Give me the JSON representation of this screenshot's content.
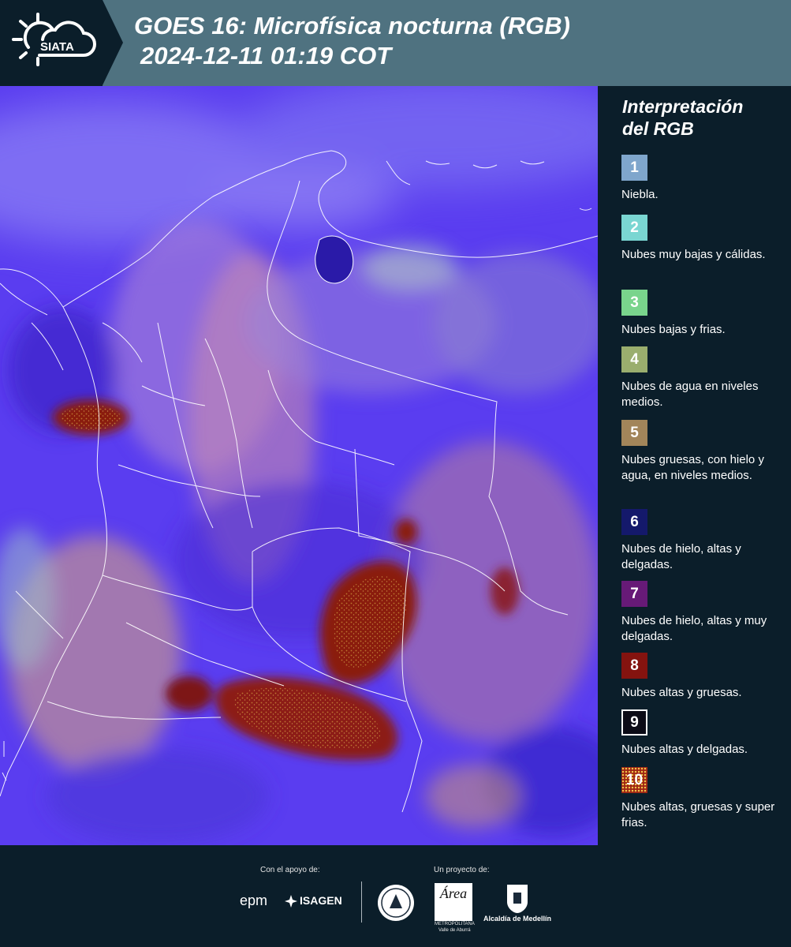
{
  "header": {
    "logo_text": "SIATA",
    "title_line1": "GOES 16: Microfísica nocturna (RGB)",
    "title_line2": "2024-12-11 01:19 COT"
  },
  "legend": {
    "title_line1": "Interpretación",
    "title_line2": "del RGB",
    "items": [
      {
        "number": "1",
        "label": "Niebla.",
        "color": "#7fa6cc"
      },
      {
        "number": "2",
        "label": "Nubes muy bajas y cálidas.",
        "color": "#7ad6d2"
      },
      {
        "number": "3",
        "label": "Nubes bajas y frias.",
        "color": "#79d48c"
      },
      {
        "number": "4",
        "label": "Nubes de agua en niveles medios.",
        "color": "#9aae6e"
      },
      {
        "number": "5",
        "label": "Nubes gruesas, con hielo y agua, en niveles medios.",
        "color": "#a2855a"
      },
      {
        "number": "6",
        "label": "Nubes de hielo, altas y delgadas.",
        "color": "#14196b"
      },
      {
        "number": "7",
        "label": "Nubes de hielo, altas y muy delgadas.",
        "color": "#671a77"
      },
      {
        "number": "8",
        "label": "Nubes altas y gruesas.",
        "color": "#84130f"
      },
      {
        "number": "9",
        "label": "Nubes altas y delgadas.",
        "color": "#0b0b16"
      },
      {
        "number": "10",
        "label": "Nubes altas, gruesas y super frias.",
        "color": "#9f2614"
      }
    ]
  },
  "footer": {
    "support_label": "Con el apoyo de:",
    "sponsor_epm": "epm",
    "sponsor_isagen": "ISAGEN",
    "project_label": "Un proyecto de:",
    "area_logo_text": "Área",
    "area_name_line1": "METROPOLITANA",
    "area_name_line2": "Valle de Aburrá",
    "alcaldia_label": "Alcaldía de Medellín"
  }
}
